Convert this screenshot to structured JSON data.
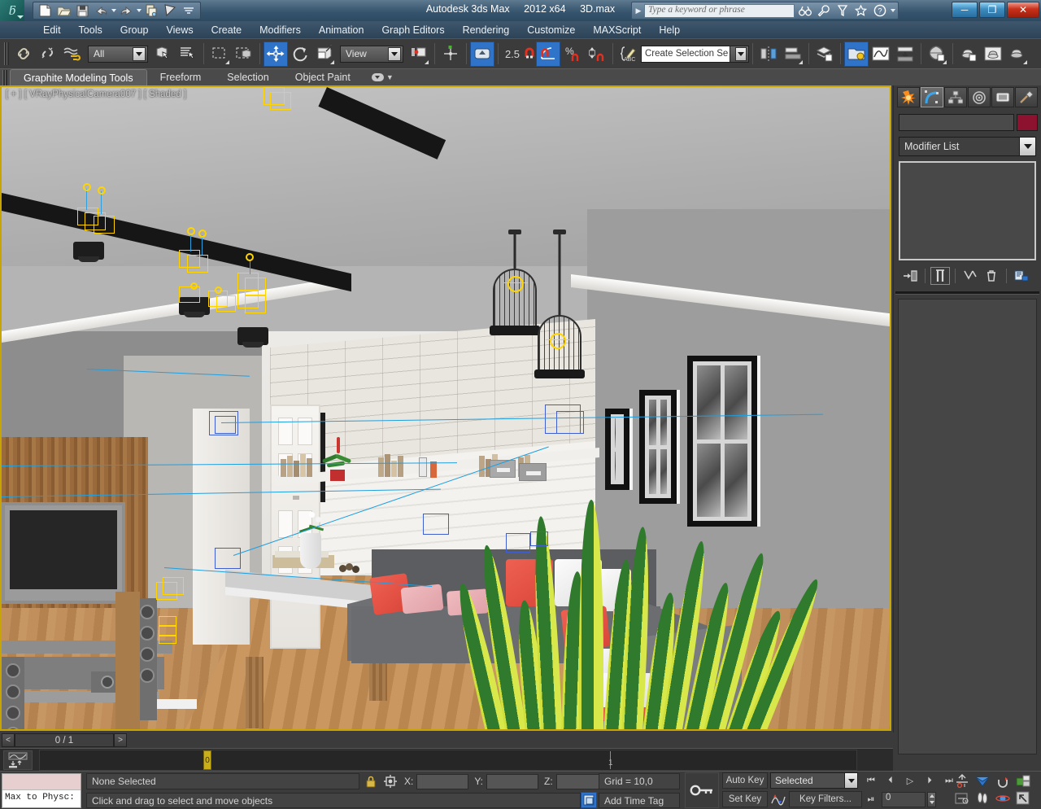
{
  "titlebar": {
    "app_name": "Autodesk 3ds Max",
    "version": "2012 x64",
    "file_name": "3D.max",
    "logo_letter": "ƃ",
    "quick_access": [
      {
        "name": "new-file-icon",
        "label": "New"
      },
      {
        "name": "open-file-icon",
        "label": "Open"
      },
      {
        "name": "save-file-icon",
        "label": "Save"
      },
      {
        "name": "undo-icon",
        "label": "Undo"
      },
      {
        "name": "redo-icon",
        "label": "Redo"
      },
      {
        "name": "set-project-folder-icon",
        "label": "Set Project Folder"
      },
      {
        "name": "select-object-icon",
        "label": "Select Object"
      }
    ],
    "search_placeholder": "Type a keyword or phrase",
    "help_icons": [
      "binoculars-icon",
      "wrench-icon",
      "subscription-icon",
      "favorites-star-icon",
      "help-icon"
    ],
    "window_buttons": {
      "minimize": "─",
      "maximize": "❐",
      "close": "✕"
    }
  },
  "menubar": {
    "items": [
      "Edit",
      "Tools",
      "Group",
      "Views",
      "Create",
      "Modifiers",
      "Animation",
      "Graph Editors",
      "Rendering",
      "Customize",
      "MAXScript",
      "Help"
    ]
  },
  "toolbar": {
    "selection_filter": "All",
    "reference_coord": "View",
    "angle_snap_value": "2.5",
    "named_selection_set": "Create Selection Se",
    "buttons": [
      {
        "name": "select-and-link-icon"
      },
      {
        "name": "unlink-selection-icon"
      },
      {
        "name": "bind-to-space-warp-icon"
      },
      {
        "name": "select-object-icon"
      },
      {
        "name": "select-by-name-icon"
      },
      {
        "name": "rectangular-selection-region-icon"
      },
      {
        "name": "window-crossing-icon"
      },
      {
        "name": "select-and-move-icon",
        "active": true
      },
      {
        "name": "select-and-rotate-icon"
      },
      {
        "name": "select-and-scale-icon"
      },
      {
        "name": "use-pivot-point-center-icon"
      },
      {
        "name": "select-and-manipulate-icon"
      },
      {
        "name": "snaps-toggle-icon",
        "active": true
      },
      {
        "name": "angle-snap-toggle-icon",
        "active": true
      },
      {
        "name": "percent-snap-toggle-icon"
      },
      {
        "name": "spinner-snap-toggle-icon"
      },
      {
        "name": "edit-named-selection-sets-icon"
      },
      {
        "name": "mirror-icon"
      },
      {
        "name": "align-icon"
      },
      {
        "name": "layer-manager-icon"
      },
      {
        "name": "schematic-view-icon",
        "active": true
      },
      {
        "name": "curve-editor-icon"
      },
      {
        "name": "dope-sheet-icon"
      },
      {
        "name": "material-editor-icon"
      },
      {
        "name": "render-setup-icon"
      },
      {
        "name": "rendered-frame-window-icon"
      },
      {
        "name": "render-production-icon"
      }
    ]
  },
  "ribbon": {
    "tabs": [
      "Graphite Modeling Tools",
      "Freeform",
      "Selection",
      "Object Paint"
    ],
    "active_tab": "Graphite Modeling Tools"
  },
  "viewport": {
    "label": "[ + ] [ VRayPhysicalCamera007 ] [ Shaded ]",
    "label_parts": {
      "corner": "[ + ]",
      "camera": "[ VRayPhysicalCamera007 ]",
      "shading": "[ Shaded ]"
    },
    "scene_description": "Interior living room render with sofa, coffee table, TV wall, pendant birdcage lamps, framed wall art and a snake plant"
  },
  "command_panel": {
    "tabs": [
      {
        "name": "create-tab",
        "icon": "star-burst-icon",
        "active": false
      },
      {
        "name": "modify-tab",
        "icon": "bent-curve-icon",
        "active": true
      },
      {
        "name": "hierarchy-tab",
        "icon": "hierarchy-icon",
        "active": false
      },
      {
        "name": "motion-tab",
        "icon": "wheel-icon",
        "active": false
      },
      {
        "name": "display-tab",
        "icon": "monitor-icon",
        "active": false
      },
      {
        "name": "utilities-tab",
        "icon": "hammer-icon",
        "active": false
      }
    ],
    "object_name": "",
    "object_color": "#8c1230",
    "modifier_list_label": "Modifier List",
    "stack_buttons": [
      {
        "name": "pin-stack-icon"
      },
      {
        "name": "show-end-result-icon",
        "boxed": true
      },
      {
        "name": "make-unique-icon"
      },
      {
        "name": "remove-modifier-icon"
      },
      {
        "name": "configure-modifier-sets-icon"
      }
    ]
  },
  "time_slider": {
    "prev_label": "<",
    "frame_label": "0 / 1",
    "next_label": ">",
    "current_key": "0",
    "end_tick": "1"
  },
  "status_bar": {
    "mini_listener_text": "Max to Physc:",
    "selection_status": "None Selected",
    "prompt": "Click and drag to select and move objects",
    "axis": {
      "x_label": "X:",
      "y_label": "Y:",
      "z_label": "Z:",
      "x_value": "",
      "y_value": "",
      "z_value": ""
    },
    "grid": "Grid = 10,0",
    "add_time_tag": "Add Time Tag",
    "lock_icon": "lock-selection-icon",
    "absolute_mode_icon": "absolute-relative-transform-icon"
  },
  "animation": {
    "auto_key_label": "Auto Key",
    "set_key_label": "Set Key",
    "key_mode": "Selected",
    "key_filters_label": "Key Filters...",
    "current_frame": "0",
    "transport": [
      {
        "name": "goto-start-button",
        "glyph": "⏮"
      },
      {
        "name": "previous-frame-button",
        "glyph": "⏴"
      },
      {
        "name": "play-animation-button",
        "glyph": "▷"
      },
      {
        "name": "next-frame-button",
        "glyph": "⏵"
      },
      {
        "name": "goto-end-button",
        "glyph": "⏭"
      },
      {
        "name": "key-mode-toggle-button",
        "glyph": "⏯"
      }
    ],
    "nav_buttons": [
      {
        "name": "time-configuration-icon"
      },
      {
        "name": "zoom-extents-all-icon"
      },
      {
        "name": "pan-view-icon"
      },
      {
        "name": "maximize-viewport-toggle-icon"
      },
      {
        "name": "field-of-view-icon"
      },
      {
        "name": "walk-through-icon"
      },
      {
        "name": "orbit-icon"
      },
      {
        "name": "zoom-region-icon"
      }
    ]
  },
  "colors": {
    "viewport_border": "#c8a400",
    "accent_blue": "#2f74c8",
    "panel_bg": "#3b3b3b",
    "titlebar_blue": "#35536c",
    "object_color": "#8c1230",
    "key_yellow": "#c9ae18",
    "gizmo_yellow": "#ffd400",
    "gizmo_blue": "#1f9fe0"
  }
}
